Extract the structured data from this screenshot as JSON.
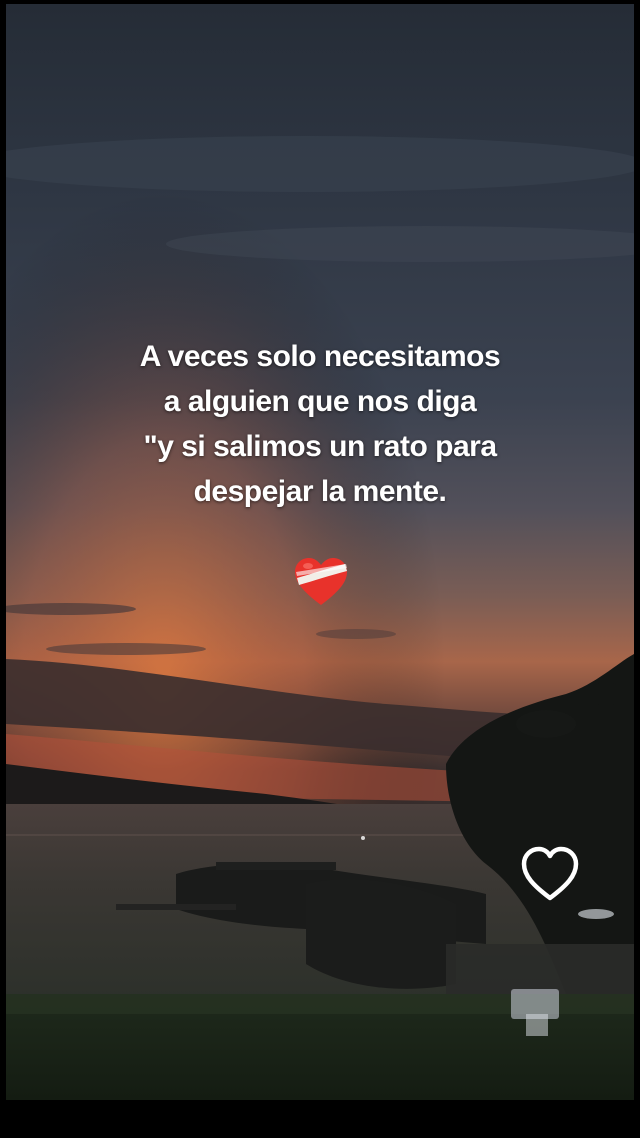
{
  "quote": {
    "line1": "A veces solo necesitamos",
    "line2": "a alguien que nos diga",
    "line3": "\"y si salimos un rato para",
    "line4": "despejar la mente."
  },
  "icons": {
    "emoji": "bandaged-heart-icon",
    "overlay": "heart-outline-icon"
  },
  "colors": {
    "sky_top": "#2b3340",
    "sunset_glow": "#c8653a",
    "heart_red": "#e8322b",
    "text": "#ffffff"
  }
}
